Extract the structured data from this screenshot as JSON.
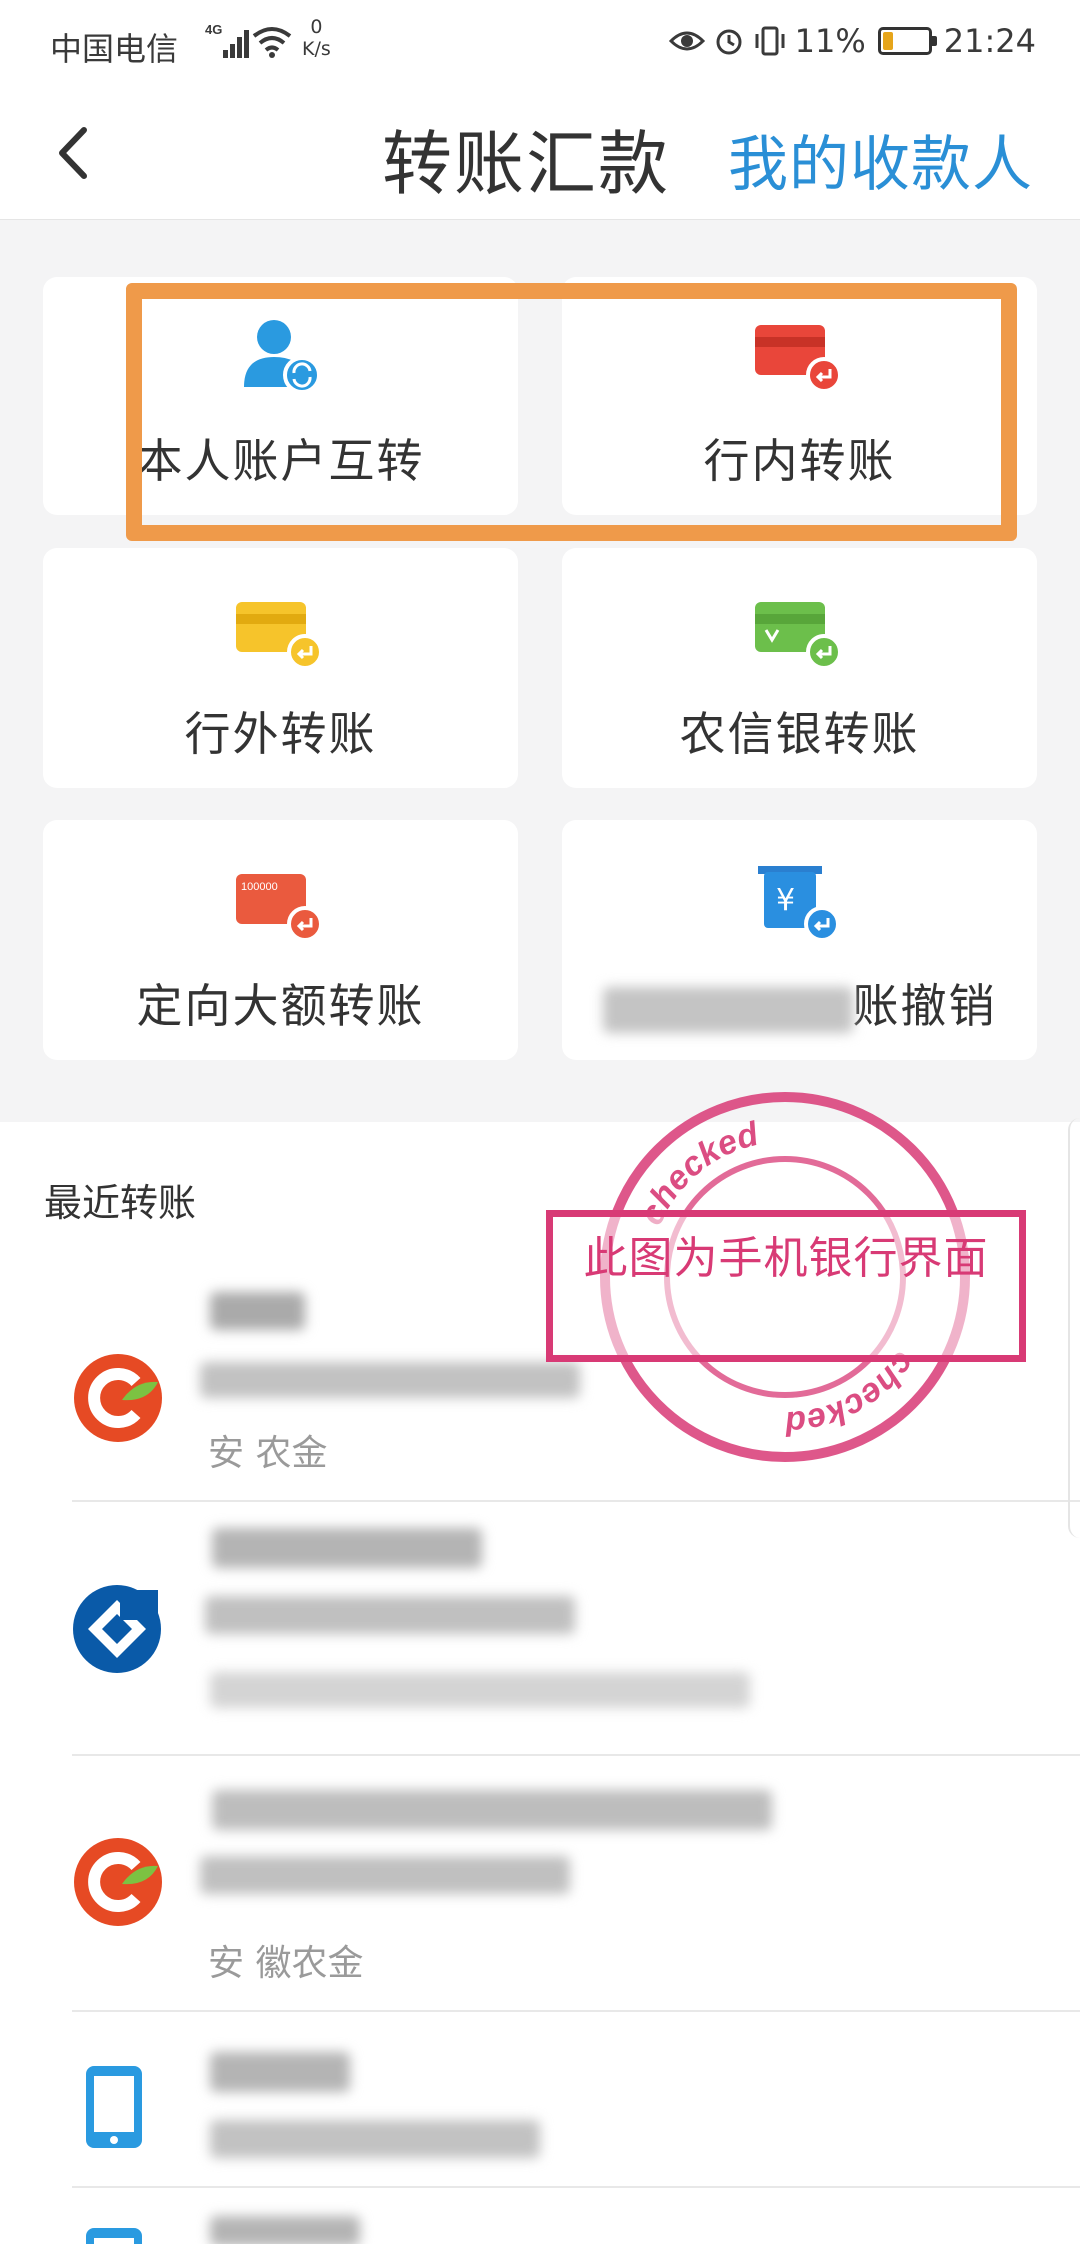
{
  "status_bar": {
    "carrier": "中国电信",
    "network": "4G",
    "speed_value": "0",
    "speed_unit": "K/s",
    "battery": "11%",
    "time": "21:24",
    "battery_color": "#e6a51a"
  },
  "nav": {
    "title": "转账汇款",
    "link": "我的收款人",
    "link_color": "#2a8fd6"
  },
  "tiles": [
    {
      "label": "本人账户互转",
      "icon": "user-sync-icon"
    },
    {
      "label": "行内转账",
      "icon": "red-card-icon"
    },
    {
      "label": "行外转账",
      "icon": "yellow-card-icon"
    },
    {
      "label": "农信银转账",
      "icon": "green-card-icon"
    },
    {
      "label": "定向大额转账",
      "icon": "large-amount-card-icon"
    },
    {
      "label": "账撤销",
      "icon": "yuan-revoke-icon"
    }
  ],
  "highlight_color": "#ef9a4a",
  "recent": {
    "title": "最近转账",
    "items": [
      {
        "bank": "安 农金",
        "logo": "rural-bank-logo-icon"
      },
      {
        "bank": "",
        "logo": "ccb-logo-icon"
      },
      {
        "bank": "安 徽农金",
        "logo": "rural-bank-logo-icon"
      },
      {
        "bank": "",
        "logo": "phone-icon"
      }
    ]
  },
  "stamp": {
    "text": "此图为手机银行界面",
    "ring_text": "checked",
    "color": "#d83a75"
  },
  "large_amount_card_text": "100000"
}
